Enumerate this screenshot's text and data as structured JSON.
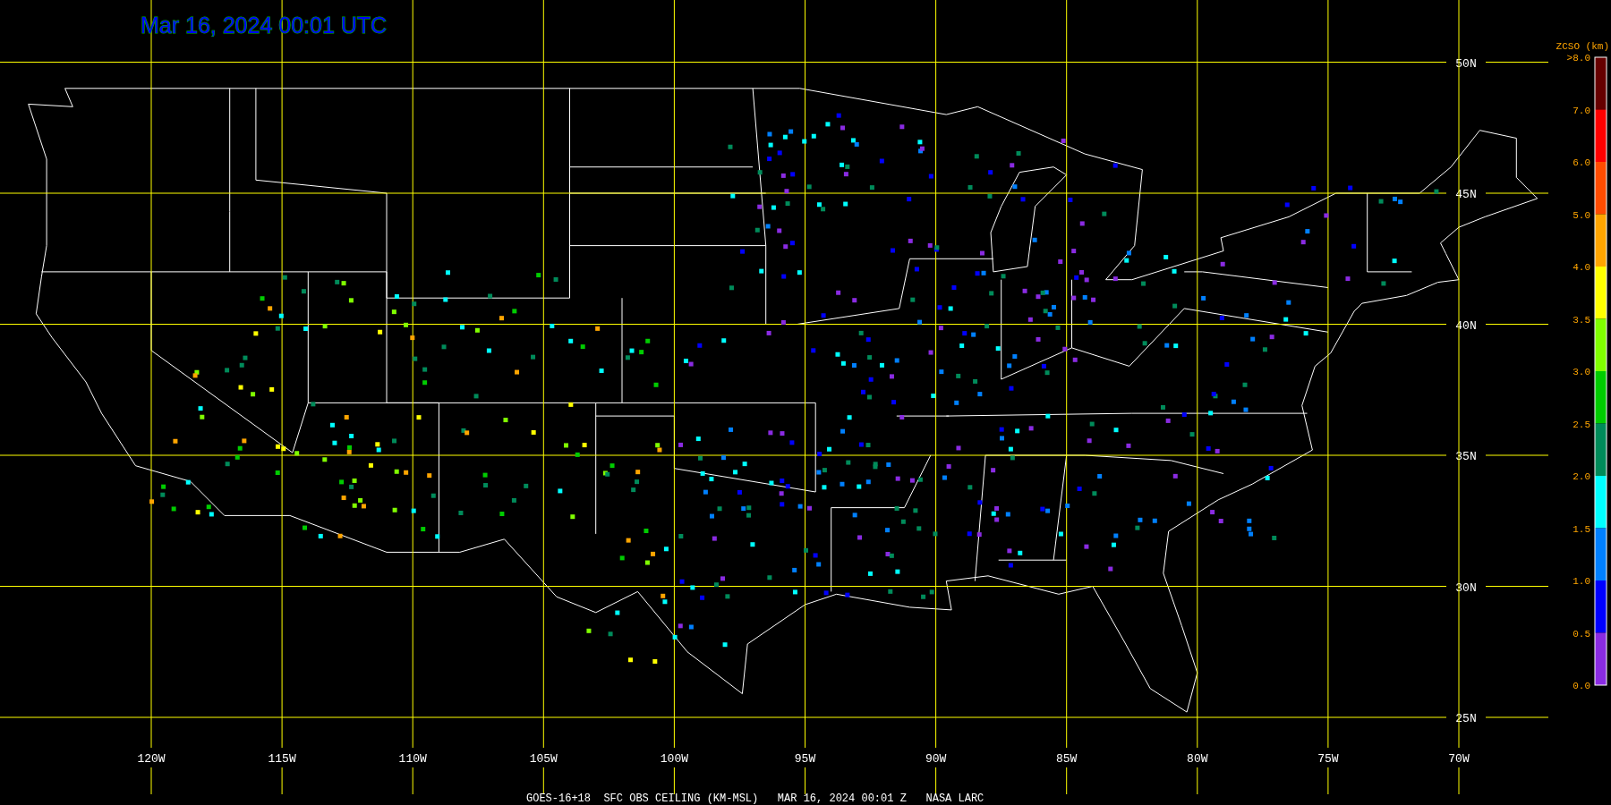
{
  "title": "Mar 16, 2024 00:01 UTC",
  "latitude_labels": [
    "50N",
    "45N",
    "40N",
    "35N",
    "30N",
    "25N"
  ],
  "longitude_labels": [
    "120W",
    "115W",
    "110W",
    "105W",
    "100W",
    "95W",
    "90W",
    "85W",
    "80W",
    "75W",
    "70W"
  ],
  "legend": {
    "title": "ZCSO (km)",
    "labels": [
      ">8.0",
      "7.0",
      "6.0",
      "5.0",
      "4.0",
      "3.5",
      "3.0",
      "2.5",
      "2.0",
      "1.5",
      "1.0",
      "0.5",
      "0.0"
    ],
    "bands": [
      {
        "color": "#660000"
      },
      {
        "color": "#ff0000"
      },
      {
        "color": "#ff4c00"
      },
      {
        "color": "#ffa500"
      },
      {
        "color": "#ffff00"
      },
      {
        "color": "#80ff00"
      },
      {
        "color": "#00cc00"
      },
      {
        "color": "#008b5a"
      },
      {
        "color": "#00ffff"
      },
      {
        "color": "#0080ff"
      },
      {
        "color": "#0000ff"
      },
      {
        "color": "#8a2be2"
      }
    ]
  },
  "caption": "GOES-16+18  SFC OBS CEILING (KM-MSL)   MAR 16, 2024 00:01 Z   NASA LARC"
}
